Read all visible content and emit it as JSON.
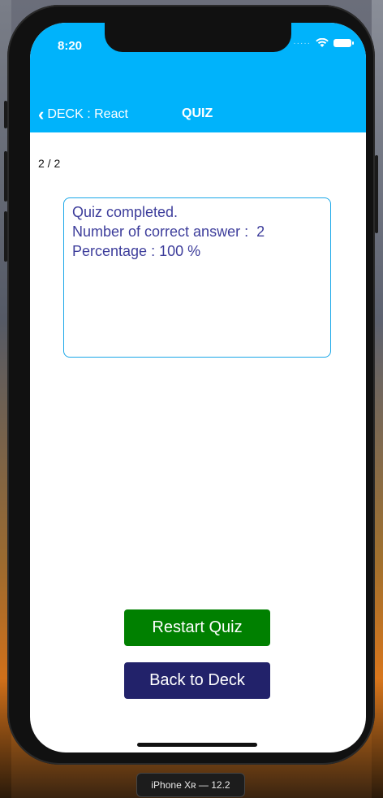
{
  "status_bar": {
    "time": "8:20"
  },
  "navbar": {
    "back_label": "DECK : React",
    "title": "QUIZ"
  },
  "quiz": {
    "counter": "2 / 2",
    "result_lines": [
      "Quiz completed.",
      "Number of correct answer :  2",
      "Percentage : 100 %"
    ]
  },
  "actions": {
    "restart_label": "Restart Quiz",
    "back_to_deck_label": "Back to Deck"
  },
  "simulator": {
    "device_label": "iPhone Xʀ — 12.2"
  },
  "colors": {
    "navbar": "#00b3fb",
    "restart_button": "#008000",
    "back_button": "#22226a",
    "result_text": "#3d3d9b",
    "card_border": "#1aa7e8"
  }
}
